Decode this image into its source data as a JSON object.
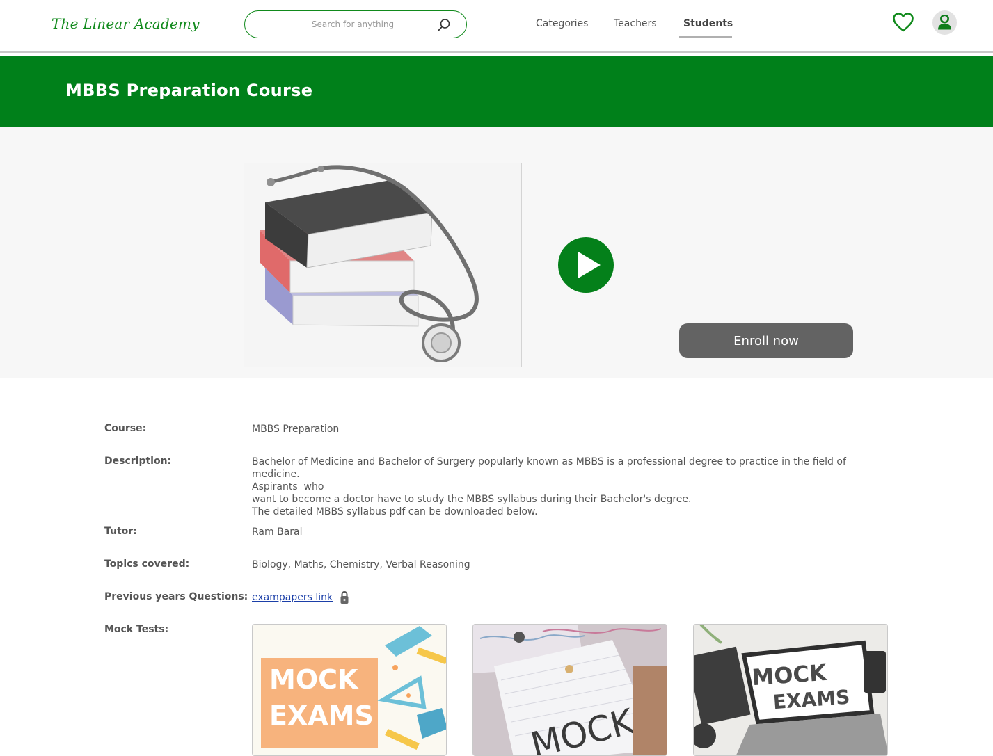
{
  "header": {
    "logo": "The Linear Academy",
    "search_placeholder": "Search for anything",
    "nav": {
      "categories": "Categories",
      "teachers": "Teachers",
      "students": "Students"
    },
    "active_nav": "Students"
  },
  "banner": {
    "title": "MBBS Preparation Course"
  },
  "hero": {
    "enroll_label": "Enroll now"
  },
  "details": {
    "course_label": "Course:",
    "course_value": "MBBS Preparation",
    "description_label": "Description:",
    "description_lines": [
      "Bachelor of Medicine and Bachelor of Surgery popularly known as MBBS is a professional degree to practice in the field of medicine.",
      "Aspirants  who",
      "want to become a doctor have to study the MBBS syllabus during their Bachelor's degree.",
      "The detailed MBBS syllabus pdf can be downloaded below."
    ],
    "tutor_label": "Tutor:",
    "tutor_value": "Ram Baral",
    "topics_label": "Topics covered:",
    "topics_value": "Biology, Maths, Chemistry, Verbal Reasoning",
    "pyq_label": "Previous years Questions:",
    "pyq_link": "exampapers link",
    "mock_label": "Mock Tests:"
  },
  "mock_cards": {
    "card1": {
      "line1": "MOCK",
      "line2": "EXAMS"
    },
    "card2": {
      "text": "MOCKS."
    },
    "card3": {
      "line1": "MOCK",
      "line2": "EXAMS"
    }
  },
  "colors": {
    "brand_green": "#00801a",
    "enroll_gray": "#636363",
    "link_blue": "#1b3fa8"
  },
  "icons": [
    "search-icon",
    "heart-icon",
    "user-icon",
    "play-icon",
    "lock-icon"
  ]
}
